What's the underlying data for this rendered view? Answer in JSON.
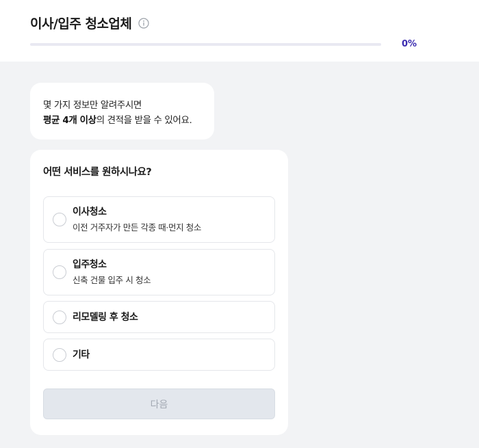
{
  "header": {
    "title": "이사/입주 청소업체",
    "progress_fraction": 0,
    "progress_text": "0%"
  },
  "intro": {
    "line1": "몇 가지 정보만 알려주시면",
    "line2_bold": "평균 4개 이상",
    "line2_rest": "의 견적을 받을 수 있어요."
  },
  "question": {
    "title": "어떤 서비스를 원하시나요?",
    "options": [
      {
        "label": "이사청소",
        "description": "이전 거주자가 만든 각종 때·먼지 청소"
      },
      {
        "label": "입주청소",
        "description": "신축 건물 입주 시 청소"
      },
      {
        "label": "리모델링 후 청소",
        "description": ""
      },
      {
        "label": "기타",
        "description": ""
      }
    ]
  },
  "next_button": {
    "label": "다음"
  },
  "colors": {
    "accent": "#4e2ec4",
    "page_background": "#f2f3f5",
    "disabled_button": "#e3e7ed"
  }
}
